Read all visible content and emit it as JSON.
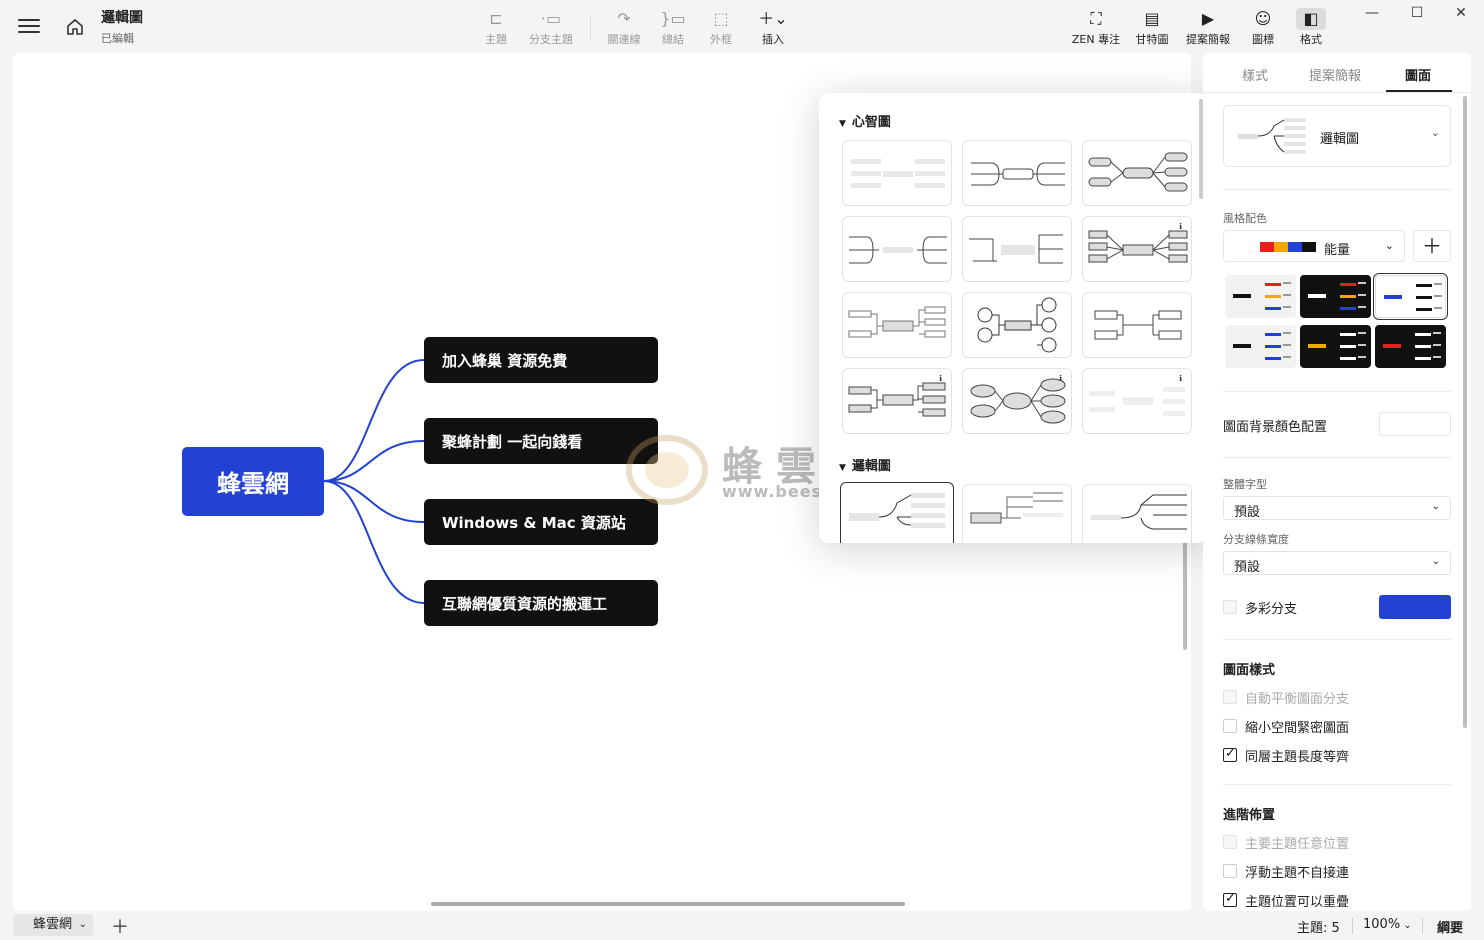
{
  "document": {
    "title": "邏輯圖",
    "status": "已編輯"
  },
  "toolbar": {
    "topic": "主題",
    "subtopic": "分支主題",
    "relationship": "關連線",
    "summary": "總結",
    "boundary": "外框",
    "insert": "插入",
    "zen": "ZEN 專注",
    "gantt": "甘特圖",
    "pitch": "提案簡報",
    "icons": "圖標",
    "format": "格式"
  },
  "mindmap": {
    "central": "蜂雲網",
    "subtopics": [
      "加入蜂巢 資源免費",
      "聚蜂計劃 一起向錢看",
      "Windows & Mac 資源站",
      "互聯網優質資源的搬運工"
    ]
  },
  "watermark": {
    "text": "蜂雲網",
    "url": "www.beesoft.vip"
  },
  "popup": {
    "section_mindmap": "心智圖",
    "section_logic": "邏輯圖"
  },
  "panel": {
    "tabs": [
      "樣式",
      "提案簡報",
      "圖面"
    ],
    "active_tab": "圖面",
    "structure": "邏輯圖",
    "scheme_label": "風格配色",
    "scheme_name": "能量",
    "scheme_colors": [
      "#e61e1e",
      "#f0a800",
      "#2342d4",
      "#111111"
    ],
    "bg_color_label": "圖面背景顏色配置",
    "font_label": "整體字型",
    "font_value": "預設",
    "branch_width_label": "分支線條寬度",
    "branch_width_value": "預設",
    "multicolor_label": "多彩分支",
    "multicolor_color": "#2342d4",
    "map_style_heading": "圖面樣式",
    "map_style_options": [
      {
        "label": "自動平衡圖面分支",
        "checked": false,
        "disabled": true
      },
      {
        "label": "縮小空間緊密圖面",
        "checked": false,
        "disabled": false
      },
      {
        "label": "同層主題長度等齊",
        "checked": true,
        "disabled": false
      }
    ],
    "advanced_heading": "進階佈置",
    "advanced_options": [
      {
        "label": "主要主題任意位置",
        "checked": false,
        "disabled": true
      },
      {
        "label": "浮動主題不自接連",
        "checked": false,
        "disabled": false
      },
      {
        "label": "主題位置可以重疊",
        "checked": true,
        "disabled": false
      }
    ]
  },
  "statusbar": {
    "sheet": "蜂雲網",
    "topic_count": "主題: 5",
    "zoom": "100%",
    "outline": "綱要"
  },
  "colors": {
    "accent": "#2342d4",
    "topic_fill": "#111111"
  }
}
